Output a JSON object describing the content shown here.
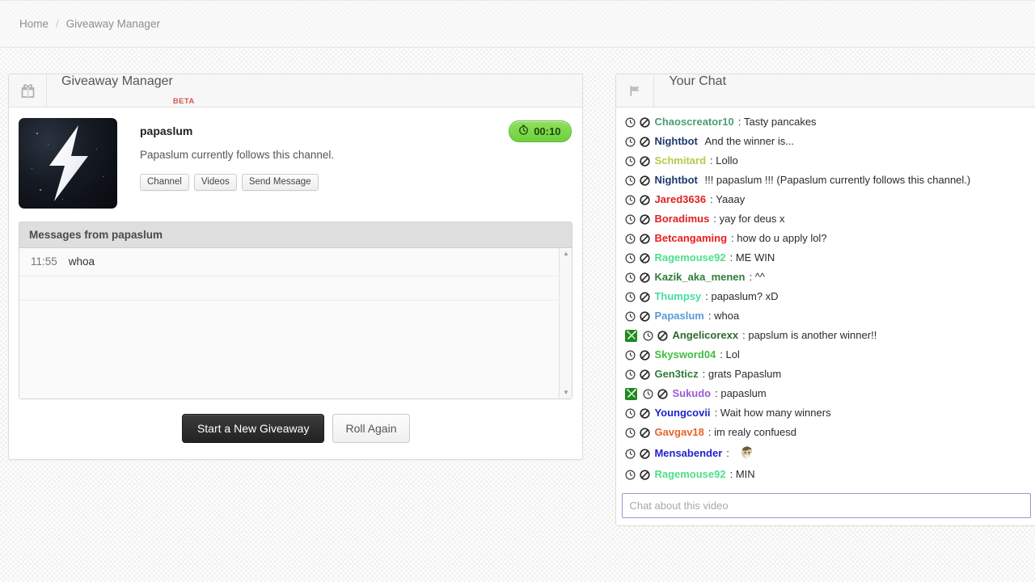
{
  "breadcrumb": {
    "home": "Home",
    "separator": "/",
    "current": "Giveaway Manager"
  },
  "giveaway_panel": {
    "icon": "gift-icon",
    "title": "Giveaway Manager",
    "beta_label": "BETA",
    "winner": {
      "name": "papaslum",
      "description": "Papaslum currently follows this channel.",
      "avatar_icon": "lightning-bolt-avatar"
    },
    "timer": {
      "icon": "stopwatch-icon",
      "value": "00:10",
      "color": "#6ed03f"
    },
    "actions": [
      {
        "label": "Channel",
        "name": "channel-button"
      },
      {
        "label": "Videos",
        "name": "videos-button"
      },
      {
        "label": "Send Message",
        "name": "send-message-button"
      }
    ],
    "messages": {
      "header": "Messages from papaslum",
      "rows": [
        {
          "time": "11:55",
          "text": "whoa"
        }
      ]
    },
    "footer": {
      "start_label": "Start a New Giveaway",
      "roll_label": "Roll Again"
    },
    "scrollbar": {
      "up": "▲",
      "down": "▼"
    }
  },
  "chat_panel": {
    "icon": "flag-icon",
    "title": "Your Chat",
    "row_icons": {
      "timeout": "clock-icon",
      "ban": "ban-icon",
      "mod": "mod-swords-badge"
    },
    "messages": [
      {
        "mod": false,
        "user": "Chaoscreator10",
        "color": "#4b9e72",
        "sep": ": ",
        "text": "Tasty pancakes"
      },
      {
        "mod": false,
        "user": "Nightbot",
        "color": "#1b3a6b",
        "sep": " ",
        "text": "And the winner is..."
      },
      {
        "mod": false,
        "user": "Schmitard",
        "color": "#b6c94a",
        "sep": ": ",
        "text": "Lollo"
      },
      {
        "mod": false,
        "user": "Nightbot",
        "color": "#1b3a6b",
        "sep": " ",
        "text": "!!! papaslum !!! (Papaslum currently follows this channel.)"
      },
      {
        "mod": false,
        "user": "Jared3636",
        "color": "#e02222",
        "sep": ": ",
        "text": "Yaaay"
      },
      {
        "mod": false,
        "user": "Boradimus",
        "color": "#e02222",
        "sep": ": ",
        "text": "yay for deus x"
      },
      {
        "mod": false,
        "user": "Betcangaming",
        "color": "#ec1c1c",
        "sep": ": ",
        "text": "how do u apply lol?"
      },
      {
        "mod": false,
        "user": "Ragemouse92",
        "color": "#4ce08a",
        "sep": ": ",
        "text": "ME WIN"
      },
      {
        "mod": false,
        "user": "Kazik_aka_menen",
        "color": "#2f7d3a",
        "sep": ": ",
        "text": "^^"
      },
      {
        "mod": false,
        "user": "Thumpsy",
        "color": "#46dda0",
        "sep": ": ",
        "text": "papaslum? xD"
      },
      {
        "mod": false,
        "user": "Papaslum",
        "color": "#5b9bd5",
        "sep": ": ",
        "text": "whoa"
      },
      {
        "mod": true,
        "user": "Angelicorexx",
        "color": "#2f6b2f",
        "sep": ": ",
        "text": "papslum is another winner!!"
      },
      {
        "mod": false,
        "user": "Skysword04",
        "color": "#3fbf3f",
        "sep": ": ",
        "text": "Lol"
      },
      {
        "mod": false,
        "user": "Gen3ticz",
        "color": "#2f7d3a",
        "sep": ": ",
        "text": "grats Papaslum"
      },
      {
        "mod": true,
        "user": "Sukudo",
        "color": "#9b5bd5",
        "sep": ": ",
        "text": "papaslum"
      },
      {
        "mod": false,
        "user": "Youngcovii",
        "color": "#2222cc",
        "sep": ": ",
        "text": "Wait how many winners"
      },
      {
        "mod": false,
        "user": "Gavgav18",
        "color": "#e8622c",
        "sep": ": ",
        "text": "im realy confuesd"
      },
      {
        "mod": false,
        "user": "Mensabender",
        "color": "#2222cc",
        "sep": ": ",
        "text": "",
        "emote": "face-emote"
      },
      {
        "mod": false,
        "user": "Ragemouse92",
        "color": "#4ce08a",
        "sep": ": ",
        "text": "MIN"
      }
    ],
    "input": {
      "placeholder": "Chat about this video",
      "value": "",
      "border_color": "#a98fd0"
    }
  }
}
